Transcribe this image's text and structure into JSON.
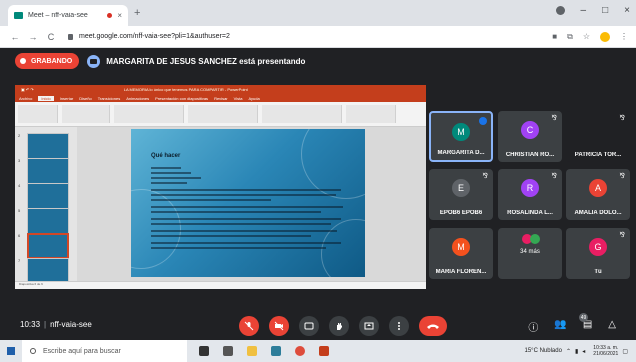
{
  "browser": {
    "tab_title": "Meet – nff-vaia-see",
    "tab_close": "×",
    "new_tab": "+",
    "url": "meet.google.com/nff-vaia-see?pli=1&authuser=2",
    "win_min": "–",
    "win_max": "□",
    "win_close": "×",
    "nav_back": "←",
    "nav_forward": "→",
    "nav_reload": "C"
  },
  "meet": {
    "recording_label": "GRABANDO",
    "presenter_text": "MARGARITA DE JESUS SANCHEZ está presentando",
    "meeting_time": "10:33",
    "meeting_sep": "|",
    "meeting_code": "nff-vaia-see",
    "people_count": "49"
  },
  "presentation": {
    "window_title": "LA MEMORIA  lo único que tenemos  PARA COMPARTIR  -  PowerPoint",
    "ribbon_tabs": [
      "Archivo",
      "Inicio",
      "Insertar",
      "Diseño",
      "Transiciones",
      "Animaciones",
      "Presentación con diapositivas",
      "Revisar",
      "Vista",
      "Ayuda"
    ],
    "slide_title": "Qué hacer",
    "thumb_numbers": [
      "2",
      "3",
      "4",
      "5",
      "6",
      "7"
    ],
    "status_text": "Diapositiva 6 de 9"
  },
  "participants": [
    {
      "name": "MARGARITA D...",
      "initial": "M",
      "color": "#00897b",
      "active": true
    },
    {
      "name": "CHRISTIAN RO...",
      "initial": "C",
      "color": "#a142f4",
      "active": false
    },
    {
      "name": "PATRICIA TOR...",
      "initial": "",
      "color": "#202124",
      "active": false
    },
    {
      "name": "EPOB6 EPOB6",
      "initial": "E",
      "color": "#5f6368",
      "active": false
    },
    {
      "name": "ROSALINDA L...",
      "initial": "R",
      "color": "#a142f4",
      "active": false
    },
    {
      "name": "AMALIA DOLO...",
      "initial": "A",
      "color": "#ea4335",
      "active": false
    },
    {
      "name": "MARIA FLOREN...",
      "initial": "M",
      "color": "#f4511e",
      "active": false
    },
    {
      "name": "34 más",
      "initial": "",
      "color": "#3c4043",
      "active": false
    },
    {
      "name": "Tú",
      "initial": "G",
      "color": "#e91e63",
      "active": false
    }
  ],
  "more_avatars": {
    "j": "J",
    "n": "9"
  },
  "taskbar": {
    "search_placeholder": "Escribe aquí para buscar",
    "weather": "15°C  Nublado",
    "time": "10:33 a. m.",
    "date": "21/06/2021"
  },
  "colors": {
    "meet_bg": "#202124",
    "record_red": "#ea4335",
    "accent_blue": "#8ab4f8",
    "ppt_orange": "#c43e1c"
  }
}
